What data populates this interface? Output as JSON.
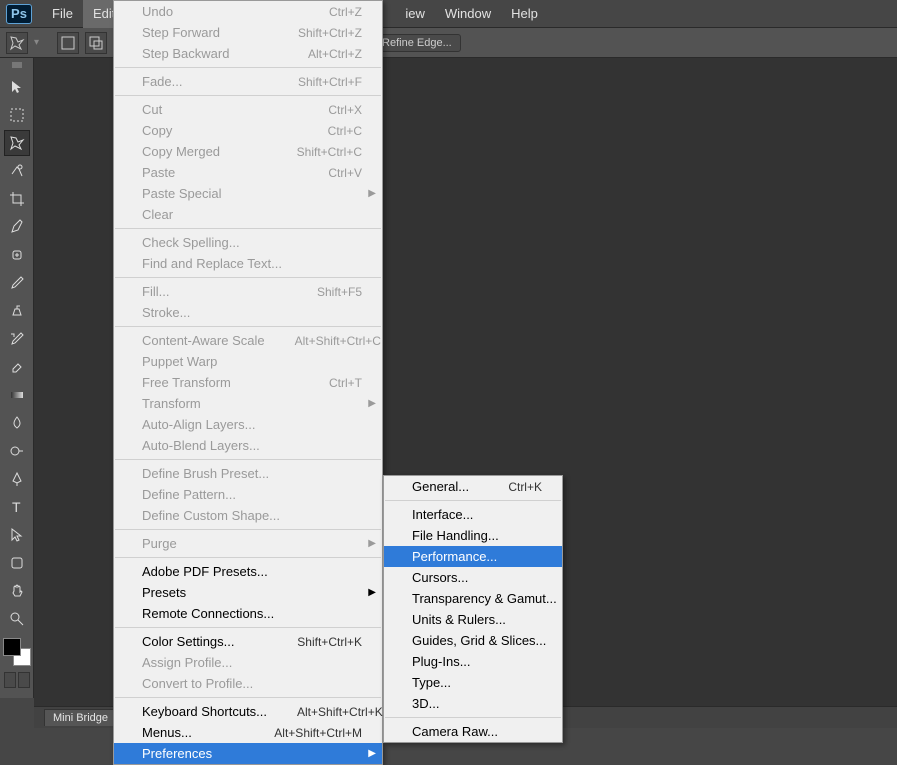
{
  "app": {
    "logo": "Ps"
  },
  "menubar": {
    "file": "File",
    "edit": "Edit",
    "view_partial": "iew",
    "window": "Window",
    "help": "Help"
  },
  "optionsbar": {
    "refine_edge": "Refine Edge..."
  },
  "edit_menu": {
    "undo": "Undo",
    "undo_sc": "Ctrl+Z",
    "step_fwd": "Step Forward",
    "step_fwd_sc": "Shift+Ctrl+Z",
    "step_bwd": "Step Backward",
    "step_bwd_sc": "Alt+Ctrl+Z",
    "fade": "Fade...",
    "fade_sc": "Shift+Ctrl+F",
    "cut": "Cut",
    "cut_sc": "Ctrl+X",
    "copy": "Copy",
    "copy_sc": "Ctrl+C",
    "copy_merged": "Copy Merged",
    "copy_merged_sc": "Shift+Ctrl+C",
    "paste": "Paste",
    "paste_sc": "Ctrl+V",
    "paste_special": "Paste Special",
    "clear": "Clear",
    "check_spelling": "Check Spelling...",
    "find_replace": "Find and Replace Text...",
    "fill": "Fill...",
    "fill_sc": "Shift+F5",
    "stroke": "Stroke...",
    "content_aware": "Content-Aware Scale",
    "content_aware_sc": "Alt+Shift+Ctrl+C",
    "puppet": "Puppet Warp",
    "free_transform": "Free Transform",
    "free_transform_sc": "Ctrl+T",
    "transform": "Transform",
    "auto_align": "Auto-Align Layers...",
    "auto_blend": "Auto-Blend Layers...",
    "def_brush": "Define Brush Preset...",
    "def_pattern": "Define Pattern...",
    "def_shape": "Define Custom Shape...",
    "purge": "Purge",
    "pdf_presets": "Adobe PDF Presets...",
    "presets": "Presets",
    "remote": "Remote Connections...",
    "color_settings": "Color Settings...",
    "color_settings_sc": "Shift+Ctrl+K",
    "assign_profile": "Assign Profile...",
    "convert_profile": "Convert to Profile...",
    "kbd_shortcuts": "Keyboard Shortcuts...",
    "kbd_shortcuts_sc": "Alt+Shift+Ctrl+K",
    "menus": "Menus...",
    "menus_sc": "Alt+Shift+Ctrl+M",
    "preferences": "Preferences"
  },
  "prefs_menu": {
    "general": "General...",
    "general_sc": "Ctrl+K",
    "interface": "Interface...",
    "file_handling": "File Handling...",
    "performance": "Performance...",
    "cursors": "Cursors...",
    "trans_gamut": "Transparency & Gamut...",
    "units_rulers": "Units & Rulers...",
    "guides": "Guides, Grid & Slices...",
    "plugins": "Plug-Ins...",
    "type": "Type...",
    "three_d": "3D...",
    "camera_raw": "Camera Raw..."
  },
  "statusbar": {
    "mini_bridge": "Mini Bridge"
  }
}
